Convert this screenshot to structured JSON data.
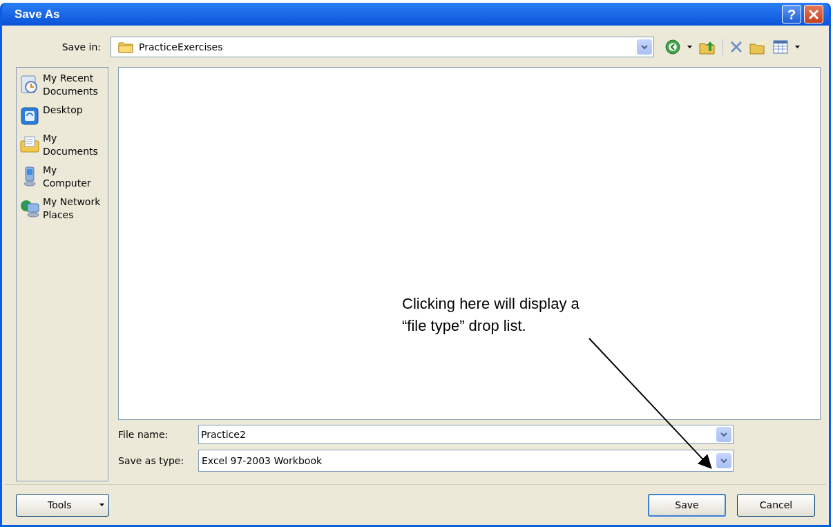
{
  "window": {
    "title": "Save As",
    "help_button": "?"
  },
  "save_in": {
    "label": "Save in:",
    "value": "PracticeExercises"
  },
  "places": [
    {
      "kind": "recent",
      "lines": [
        "My Recent",
        "Documents"
      ]
    },
    {
      "kind": "desktop",
      "lines": [
        "Desktop"
      ]
    },
    {
      "kind": "documents",
      "lines": [
        "My",
        "Documents"
      ]
    },
    {
      "kind": "computer",
      "lines": [
        "My",
        "Computer"
      ]
    },
    {
      "kind": "network",
      "lines": [
        "My Network",
        "Places"
      ]
    }
  ],
  "file_name": {
    "label": "File name:",
    "value": "Practice2"
  },
  "save_as_type": {
    "label": "Save as type:",
    "value": "Excel 97-2003 Workbook"
  },
  "buttons": {
    "tools": "Tools",
    "save": "Save",
    "cancel": "Cancel"
  },
  "annotation": {
    "lines": [
      "Clicking here will display a",
      "“file type” drop list."
    ]
  }
}
